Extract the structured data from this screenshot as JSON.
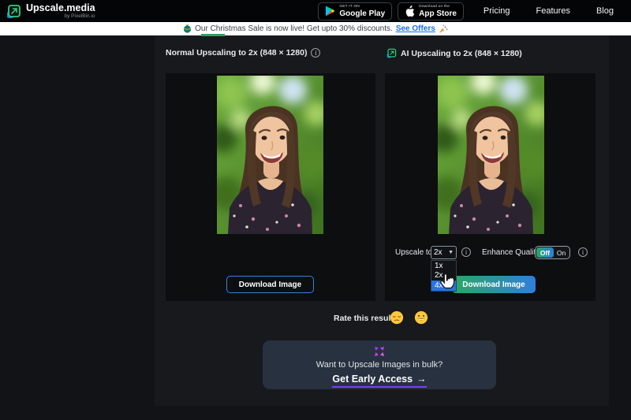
{
  "navbar": {
    "logo": {
      "title": "Upscale.media",
      "subtitle": "by PixelBin.io"
    },
    "badges": {
      "google": {
        "top": "GET IT ON",
        "bottom": "Google Play"
      },
      "apple": {
        "top": "Download on the",
        "bottom": "App Store"
      }
    },
    "links": [
      "Pricing",
      "Features",
      "Blog"
    ]
  },
  "banner": {
    "text": "Our Christmas Sale is now live! Get upto 30% discounts.",
    "link": "See Offers",
    "left_emoji": "festive-ornament",
    "right_emoji": "party-popper"
  },
  "panels": {
    "normal": {
      "title": "Normal Upscaling to 2x (848 × 1280)",
      "download_label": "Download Image"
    },
    "ai": {
      "title": "AI Upscaling to 2x (848 × 1280)",
      "download_label": "Download Image",
      "controls": {
        "upscale_label": "Upscale to",
        "selected": "2x",
        "options": [
          "1x",
          "2x",
          "4x"
        ],
        "highlighted_option": "4x",
        "enhance_label": "Enhance Quality",
        "toggle_off": "Off",
        "toggle_on": "On",
        "toggle_state": "Off"
      }
    }
  },
  "photo": {
    "alt": "Smiling woman with long brown hair in a dark floral top against green foliage bokeh"
  },
  "rate": {
    "label": "Rate this result:",
    "emojis": [
      "pensive-face",
      "grinning-face"
    ]
  },
  "bulk_card": {
    "question": "Want to Upscale Images in bulk?",
    "cta": "Get Early Access",
    "arrow": "→"
  },
  "colors": {
    "accent_green": "#28a862",
    "accent_blue": "#2f7fdc",
    "link_blue": "#1a6fe8",
    "dropdown_highlight": "#2474e8",
    "cta_underline": "#7b3ff2",
    "indicator_green": "#2f9e63"
  }
}
